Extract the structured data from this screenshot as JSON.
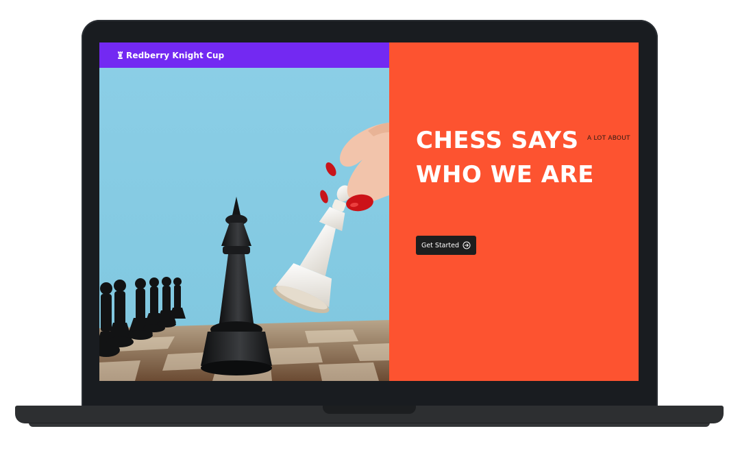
{
  "navbar": {
    "brand_name": "Redberry Knight Cup",
    "brand_icon": "chess-rook-icon"
  },
  "hero": {
    "headline_line1": "CHESS SAYS",
    "headline_line2": "WHO WE ARE",
    "subtag": "A LOT ABOUT",
    "cta_label": "Get Started",
    "cta_icon": "arrow-circle-right-icon"
  },
  "colors": {
    "navbar": "#7329f2",
    "hero_accent": "#fd5330",
    "cta_background": "#1e1e1e",
    "sky": "#88cde4"
  }
}
